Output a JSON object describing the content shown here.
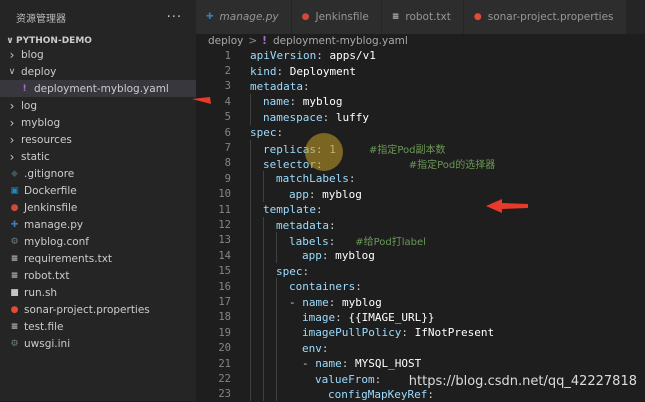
{
  "sidebar": {
    "title": "资源管理器",
    "more_icon": "···",
    "project": "PYTHON-DEMO",
    "items": [
      {
        "label": "blog",
        "type": "folder",
        "expanded": false,
        "depth": 1
      },
      {
        "label": "deploy",
        "type": "folder",
        "expanded": true,
        "depth": 1
      },
      {
        "label": "deployment-myblog.yaml",
        "type": "yaml",
        "depth": 2,
        "selected": true
      },
      {
        "label": "log",
        "type": "folder",
        "expanded": false,
        "depth": 1
      },
      {
        "label": "myblog",
        "type": "folder",
        "expanded": false,
        "depth": 1
      },
      {
        "label": "resources",
        "type": "folder",
        "expanded": false,
        "depth": 1
      },
      {
        "label": "static",
        "type": "folder",
        "expanded": false,
        "depth": 1
      },
      {
        "label": ".gitignore",
        "type": "git",
        "depth": 1
      },
      {
        "label": "Dockerfile",
        "type": "docker",
        "depth": 1
      },
      {
        "label": "Jenkinsfile",
        "type": "jenkins",
        "depth": 1
      },
      {
        "label": "manage.py",
        "type": "py",
        "depth": 1
      },
      {
        "label": "myblog.conf",
        "type": "conf",
        "depth": 1
      },
      {
        "label": "requirements.txt",
        "type": "txt",
        "depth": 1
      },
      {
        "label": "robot.txt",
        "type": "txt",
        "depth": 1
      },
      {
        "label": "run.sh",
        "type": "sh",
        "depth": 1
      },
      {
        "label": "sonar-project.properties",
        "type": "prop",
        "depth": 1
      },
      {
        "label": "test.file",
        "type": "file",
        "depth": 1
      },
      {
        "label": "uwsgi.ini",
        "type": "ini",
        "depth": 1
      }
    ]
  },
  "tabs": [
    {
      "label": "manage.py",
      "icon": "python-icon",
      "italic": true
    },
    {
      "label": "Jenkinsfile",
      "icon": "jenkins-icon",
      "italic": false
    },
    {
      "label": "robot.txt",
      "icon": "text-file-icon",
      "italic": false
    },
    {
      "label": "sonar-project.properties",
      "icon": "properties-icon",
      "italic": false
    }
  ],
  "breadcrumb": {
    "folder": "deploy",
    "file": "deployment-myblog.yaml"
  },
  "code_lines": [
    {
      "n": "1"
    },
    {
      "n": "2"
    },
    {
      "n": "3"
    },
    {
      "n": "4"
    },
    {
      "n": "5"
    },
    {
      "n": "6"
    },
    {
      "n": "7"
    },
    {
      "n": "8"
    },
    {
      "n": "9"
    },
    {
      "n": "10"
    },
    {
      "n": "11"
    },
    {
      "n": "12"
    },
    {
      "n": "13"
    },
    {
      "n": "14"
    },
    {
      "n": "15"
    },
    {
      "n": "16"
    },
    {
      "n": "17"
    },
    {
      "n": "18"
    },
    {
      "n": "19"
    },
    {
      "n": "20"
    },
    {
      "n": "21"
    },
    {
      "n": "22"
    },
    {
      "n": "23"
    }
  ],
  "code": {
    "l1_key": "apiVersion",
    "l1_val": "apps/v1",
    "l2_key": "kind",
    "l2_val": "Deployment",
    "l3_key": "metadata",
    "l4_key": "name",
    "l4_val": "myblog",
    "l5_key": "namespace",
    "l5_val": "luffy",
    "l6_key": "spec",
    "l7_key": "replicas",
    "l7_val": "1",
    "l7_comment": "#指定Pod副本数",
    "l8_key": "selector",
    "l8_comment": "#指定Pod的选择器",
    "l9_key": "matchLabels",
    "l10_key": "app",
    "l10_val": "myblog",
    "l11_key": "template",
    "l12_key": "metadata",
    "l13_key": "labels",
    "l13_comment": "#给Pod打label",
    "l14_key": "app",
    "l14_val": "myblog",
    "l15_key": "spec",
    "l16_key": "containers",
    "l17_key": "name",
    "l17_val": "myblog",
    "l18_key": "image",
    "l18_val": "{{IMAGE_URL}}",
    "l19_key": "imagePullPolicy",
    "l19_val": "IfNotPresent",
    "l20_key": "env",
    "l21_key": "name",
    "l21_val": "MYSQL_HOST",
    "l22_key": "valueFrom",
    "l23_key": "configMapKeyRef"
  },
  "watermark": "https://blog.csdn.net/qq_42227818",
  "colors": {
    "arrow": "#e8392b",
    "key": "#9cdcfe",
    "comment": "#6a9955",
    "selection": "#37373d"
  }
}
